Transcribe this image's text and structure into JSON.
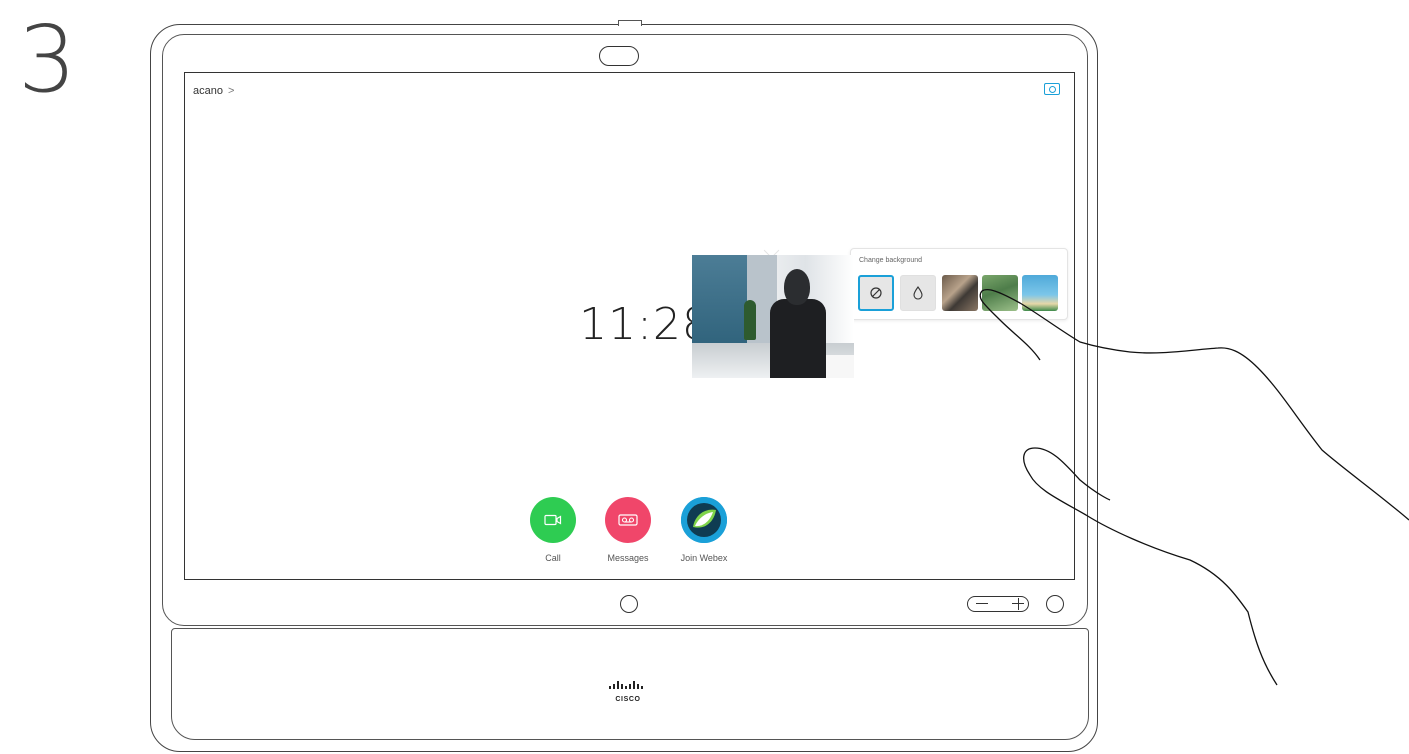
{
  "step": "3",
  "screen": {
    "brand": "acano",
    "brand_chevron": ">",
    "clock": "11:28"
  },
  "background_panel": {
    "title": "Change background",
    "options": [
      "none",
      "blur",
      "image-office",
      "image-nature",
      "image-beach"
    ],
    "selected": "none",
    "accent_color": "#1aa0d8"
  },
  "actions": [
    {
      "label": "Call",
      "color": "#2ecc52",
      "icon": "camera-icon"
    },
    {
      "label": "Messages",
      "color": "#f0466a",
      "icon": "voicemail-icon"
    },
    {
      "label": "Join Webex",
      "color": "#1aa0d8",
      "icon": "webex-icon"
    }
  ],
  "device": {
    "logo_text": "CISCO"
  }
}
